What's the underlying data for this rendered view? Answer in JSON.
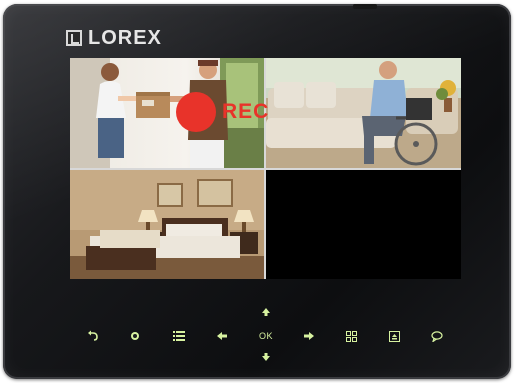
{
  "brand": {
    "name": "LOREX"
  },
  "screen": {
    "recording_label": "REC",
    "panes": [
      {
        "name": "camera-1",
        "scene": "delivery"
      },
      {
        "name": "camera-2",
        "scene": "living-room"
      },
      {
        "name": "camera-3",
        "scene": "bedroom"
      },
      {
        "name": "camera-4",
        "scene": "no-signal"
      }
    ]
  },
  "controls": {
    "ok_label": "OK",
    "icons": [
      "back-icon",
      "power-icon",
      "menu-icon",
      "left-arrow-icon",
      "up-arrow-icon",
      "down-arrow-icon",
      "right-arrow-icon",
      "quad-view-icon",
      "select-icon",
      "talk-icon"
    ],
    "button_color": "#d7f2a0"
  },
  "colors": {
    "rec": "#e8332a",
    "bezel": "#17181b"
  }
}
